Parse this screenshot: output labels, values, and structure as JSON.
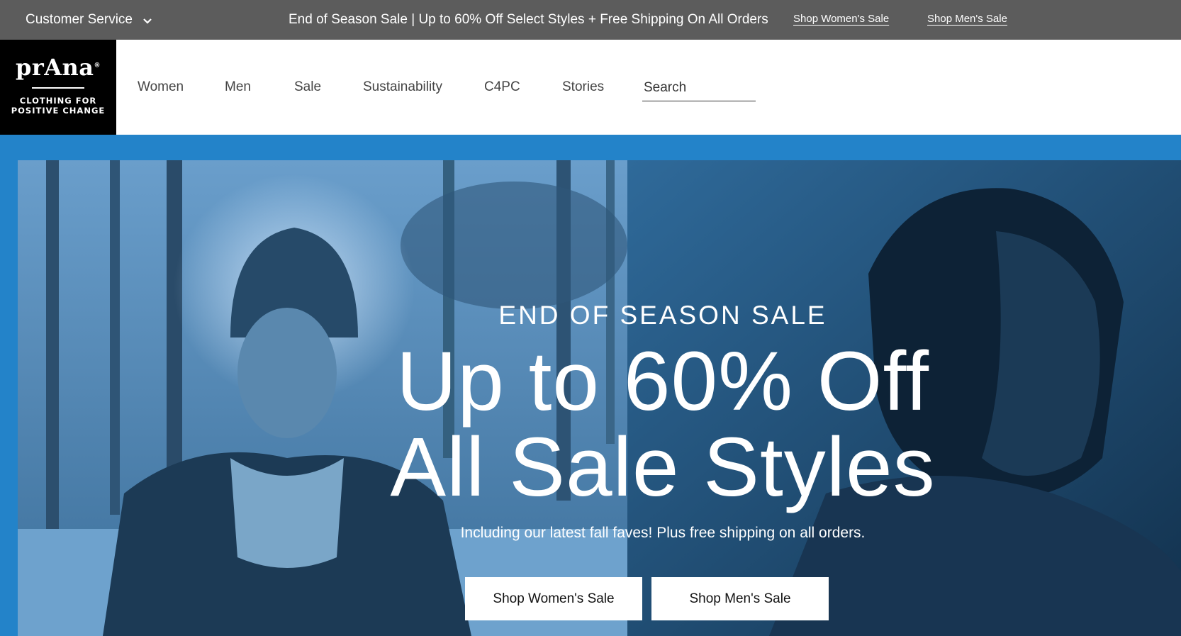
{
  "topbar": {
    "customer_service": "Customer Service",
    "promo": "End of Season Sale | Up to 60% Off Select Styles + Free Shipping On All Orders",
    "links": [
      "Shop Women's Sale",
      "Shop Men's Sale"
    ]
  },
  "logo": {
    "wordmark": "prAna",
    "tagline_line1": "CLOTHING FOR",
    "tagline_line2": "POSITIVE CHANGE"
  },
  "nav": {
    "items": [
      "Women",
      "Men",
      "Sale",
      "Sustainability",
      "C4PC",
      "Stories"
    ],
    "search_placeholder": "Search"
  },
  "hero": {
    "eyebrow": "END OF SEASON SALE",
    "headline_line1": "Up to 60% Off",
    "headline_line2": "All Sale Styles",
    "subline": "Including our latest fall faves! Plus free shipping on all orders.",
    "cta_women": "Shop Women's Sale",
    "cta_men": "Shop Men's Sale"
  },
  "colors": {
    "topbar": "#5c5c5c",
    "hero_frame": "#2383c9",
    "hero_tint": "#1f4e73",
    "logo_bg": "#000000"
  },
  "icons": {
    "customer_service": "chevron-down-icon"
  }
}
